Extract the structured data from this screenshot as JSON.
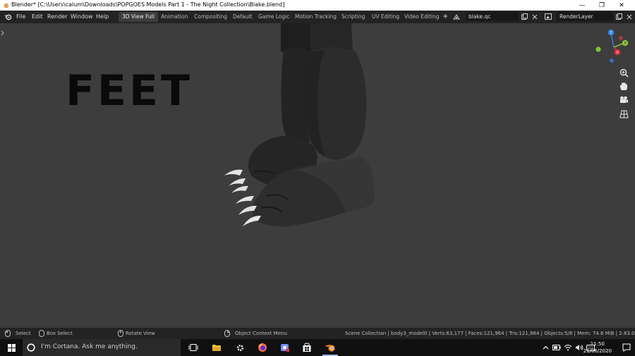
{
  "window": {
    "title": "Blender* [C:\\Users\\calum\\Downloads\\POPGOES Models Part 1 - The Night Collection\\Blake.blend]",
    "minimize_glyph": "—",
    "maximize_glyph": "❐",
    "close_glyph": "✕"
  },
  "menu": {
    "items": [
      "File",
      "Edit",
      "Render",
      "Window",
      "Help"
    ]
  },
  "workspace_tabs": [
    "3D View Full",
    "Animation",
    "Compositing",
    "Default",
    "Game Logic",
    "Motion Tracking",
    "Scripting",
    "UV Editing",
    "Video Editing"
  ],
  "add_tab_glyph": "+",
  "scene": {
    "name": "blake.qc"
  },
  "view_layer": {
    "name": "RenderLayer"
  },
  "viewport": {
    "overlay_text": "FEET",
    "gizmo": {
      "z_label": "Z",
      "y_label": "Y",
      "x_label": "X"
    }
  },
  "statusbar": {
    "select": "Select",
    "box_select": "Box Select",
    "rotate_view": "Rotate View",
    "context_menu": "Object Context Menu",
    "stats": "Scene Collection | body3_model0 | Verts:63,177 | Faces:121,964 | Tris:121,964 | Objects:5/8 | Mem: 74.6 MiB | 2.83.0"
  },
  "taskbar": {
    "cortana_placeholder": "I'm Cortana. Ask me anything.",
    "time": "11:50",
    "date": "21/06/2020"
  },
  "colors": {
    "accent_blue": "#4772b3",
    "axis_x": "#e0303a",
    "axis_y": "#8cc23a",
    "axis_z": "#2f83e6"
  }
}
